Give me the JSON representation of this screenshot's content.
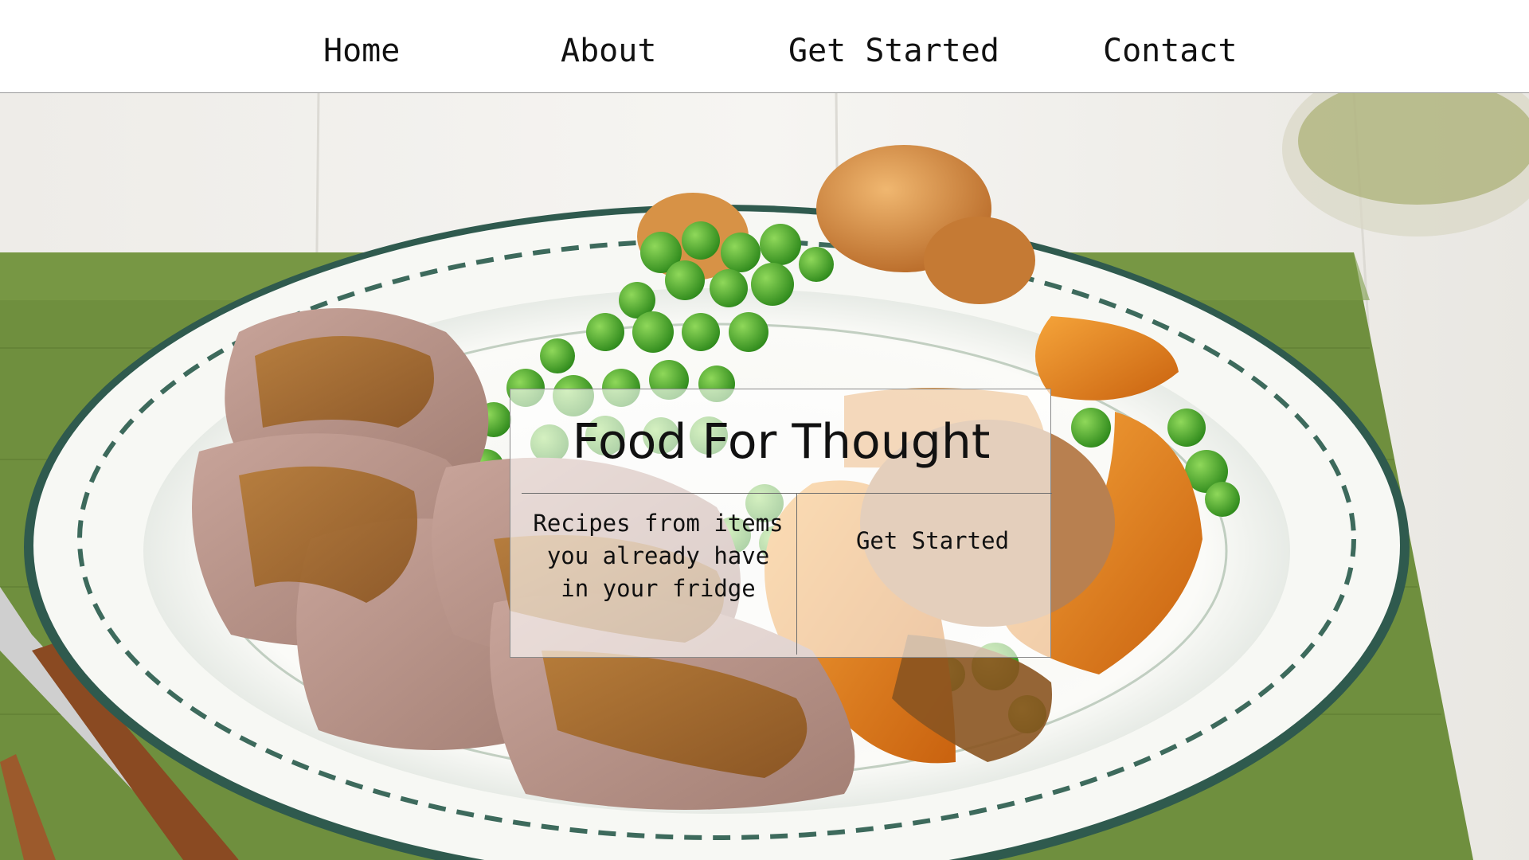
{
  "nav": {
    "items": [
      {
        "label": "Home"
      },
      {
        "label": "About"
      },
      {
        "label": "Get Started"
      },
      {
        "label": "Contact"
      }
    ]
  },
  "hero": {
    "image_alt": "roast meat with gravy, peas, roasted potatoes and pumpkin on a white plate",
    "card": {
      "title": "Food For Thought",
      "tagline": "Recipes from items you already have in your fridge",
      "cta_label": "Get Started"
    }
  },
  "colors": {
    "nav_bg": "#ffffff",
    "text": "#111111",
    "card_bg": "rgba(255,255,255,0.62)",
    "napkin": "#6f8f3e",
    "plate_rim": "#2f5a4e",
    "gravy": "#9a6326",
    "peas": "#4aa02c",
    "pumpkin": "#e0821c"
  }
}
